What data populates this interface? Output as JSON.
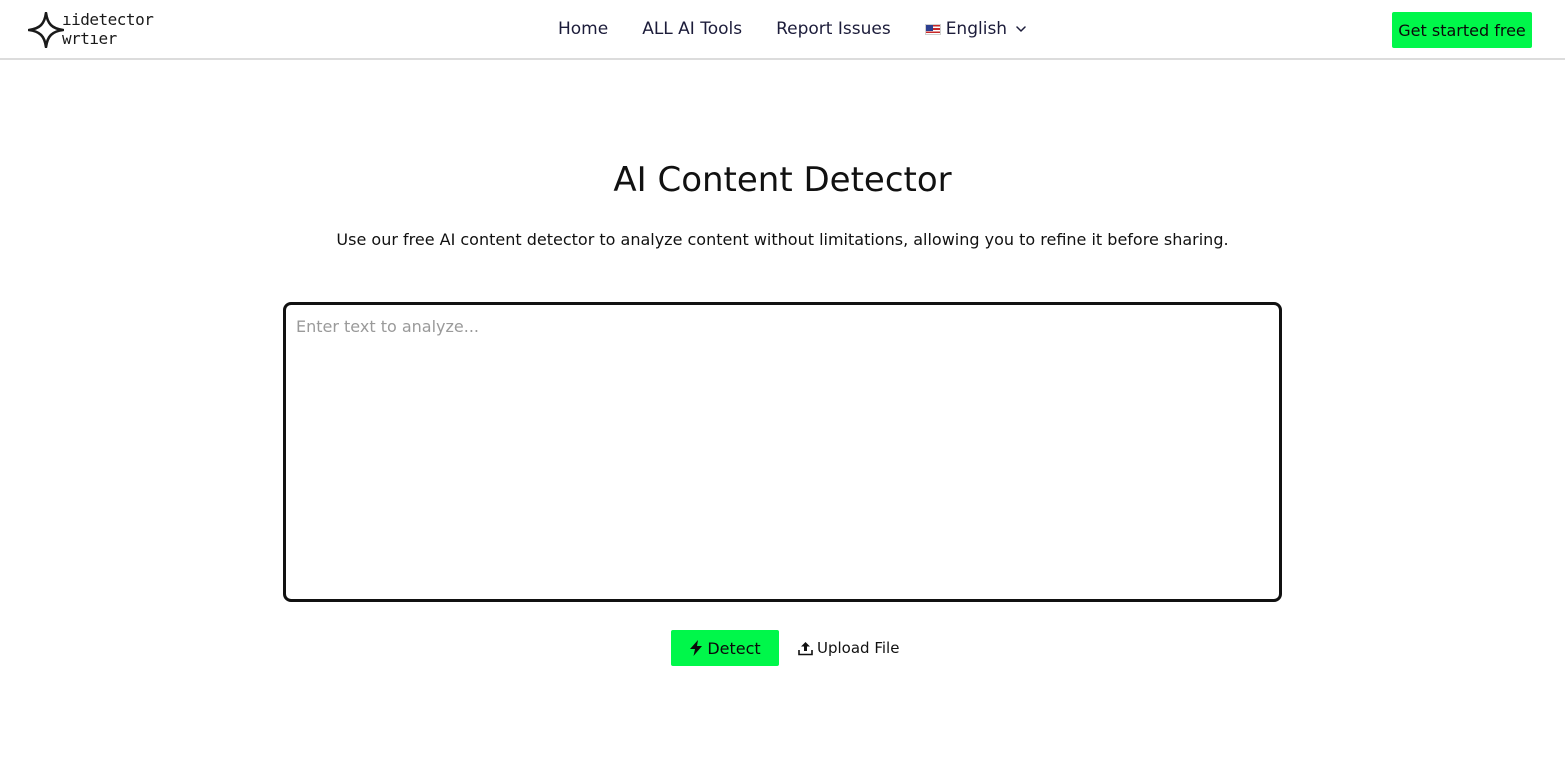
{
  "brand": {
    "line1": "ıidetector",
    "line2": "wrtıer"
  },
  "nav": {
    "items": [
      {
        "label": "Home"
      },
      {
        "label": "ALL AI Tools"
      },
      {
        "label": "Report Issues"
      }
    ],
    "language": "English",
    "cta_label": "Get started free"
  },
  "hero": {
    "title": "AI Content Detector",
    "subtitle": "Use our free AI content detector to analyze content without limitations, allowing you to refine it before sharing."
  },
  "editor": {
    "placeholder": "Enter text to analyze...",
    "value": ""
  },
  "actions": {
    "detect_label": "Detect",
    "upload_label": "Upload File"
  },
  "colors": {
    "accent": "#00f74a",
    "text": "#111111",
    "nav_text": "#1c1c3a"
  },
  "icons": {
    "logo": "four-point-star-icon",
    "language": "us-flag-icon",
    "dropdown": "chevron-down-icon",
    "detect": "lightning-bolt-icon",
    "upload": "upload-icon"
  }
}
